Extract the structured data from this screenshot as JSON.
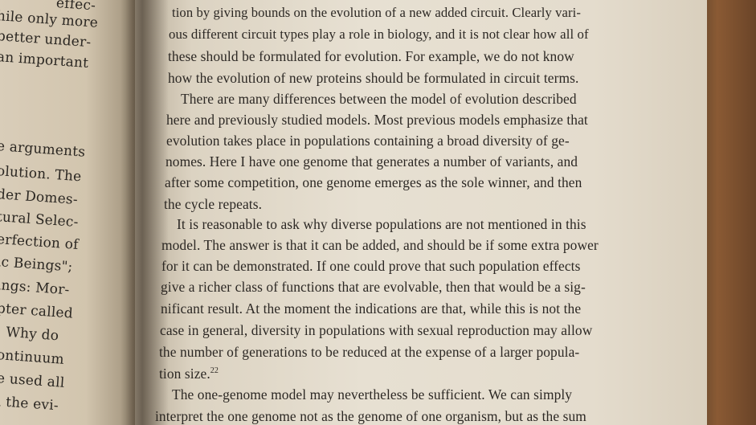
{
  "left_page": {
    "fragments": [
      "effec-",
      "hile only more",
      "better under-",
      "an important",
      "e arguments",
      "olution. The",
      "der Domes-",
      "tural Selec-",
      "erfection of",
      "ic Beings\";",
      "ings: Mor-",
      "pter called",
      ": Why do",
      "ontinuum",
      "e used all",
      "l the evi-"
    ]
  },
  "right_page": {
    "lines": [
      "tion by giving bounds on the evolution of a new added circuit. Clearly vari-",
      "ous different circuit types play a role in biology, and it is not clear how all of",
      "these should be formulated for evolution. For example, we do not know",
      "how the evolution of new proteins should be formulated in circuit terms.",
      "There are many differences between the model of evolution described",
      "here and previously studied models. Most previous models emphasize that",
      "evolution takes place in populations containing a broad diversity of ge-",
      "nomes. Here I have one genome that generates a number of variants, and",
      "after some competition, one genome emerges as the sole winner, and then",
      "the cycle repeats.",
      "It is reasonable to ask why diverse populations are not mentioned in this",
      "model. The answer is that it can be added, and should be if some extra power",
      "for it can be demonstrated. If one could prove that such population effects",
      "give a richer class of functions that are evolvable, then that would be a sig-",
      "nificant result. At the moment the indications are that, while this is not the",
      "case in general, diversity in populations with sexual reproduction may allow",
      "the number of generations to be reduced at the expense of a larger popula-",
      "tion size.",
      "The one-genome model may nevertheless be sufficient. We can simply",
      "interpret the one genome not as the genome of one organism, but as the sum"
    ],
    "footnote_marker": "22"
  }
}
